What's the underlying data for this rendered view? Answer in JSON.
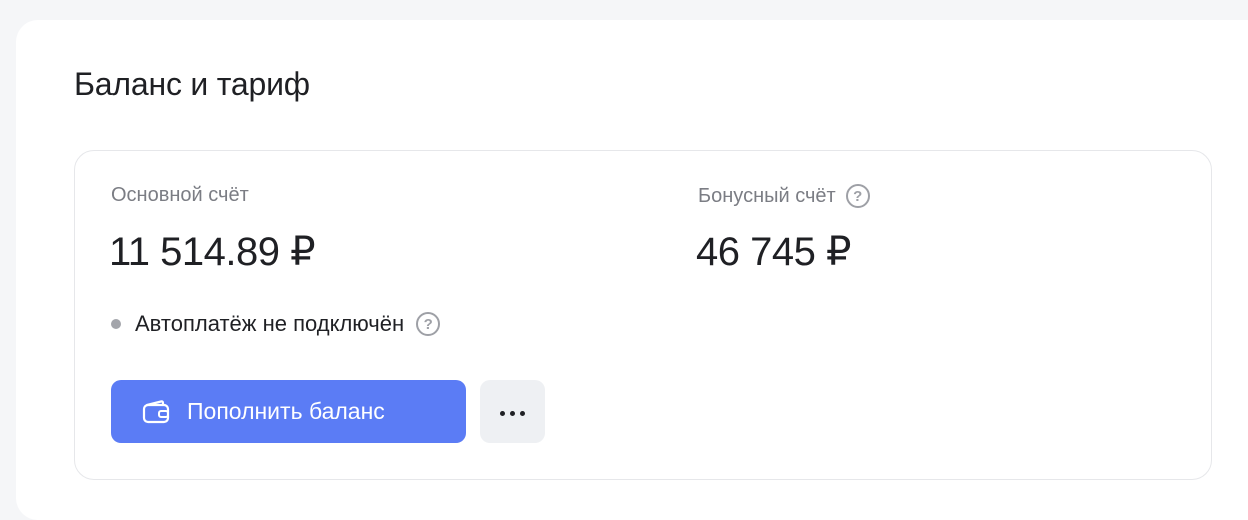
{
  "section": {
    "title": "Баланс и тариф"
  },
  "main_account": {
    "label": "Основной счёт",
    "value": "11 514.89 ₽"
  },
  "bonus_account": {
    "label": "Бонусный счёт",
    "value": "46 745 ₽",
    "help_icon": "question-circle-icon"
  },
  "autopay": {
    "status_text": "Автоплатёж не подключён",
    "status_color": "#a3a5ab",
    "help_icon": "question-circle-icon"
  },
  "actions": {
    "topup_label": "Пополнить баланс",
    "topup_icon": "wallet-icon",
    "more_icon": "more-dots-icon"
  },
  "colors": {
    "accent": "#5b7cf5",
    "secondary_button_bg": "#eef0f3",
    "page_bg": "#f5f6f8"
  }
}
